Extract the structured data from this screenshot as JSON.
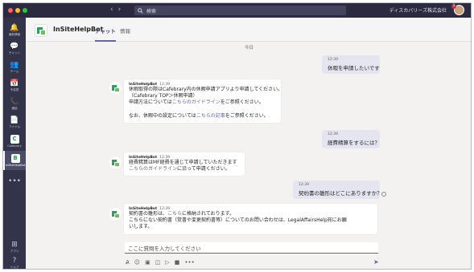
{
  "window": {
    "search_placeholder": "検索",
    "org_name": "ディスカバリーズ株式会社",
    "notification_count": "1",
    "nav_back": "‹",
    "nav_forward": "›"
  },
  "rail": {
    "items": [
      {
        "label": "最新情報",
        "icon": "bell-icon",
        "glyph": "🔔"
      },
      {
        "label": "チャット",
        "icon": "chat-icon",
        "glyph": "💬"
      },
      {
        "label": "チーム",
        "icon": "teams-icon",
        "glyph": "👥"
      },
      {
        "label": "予定表",
        "icon": "calendar-icon",
        "glyph": "📅"
      },
      {
        "label": "通話",
        "icon": "phone-icon",
        "glyph": "📞"
      },
      {
        "label": "ファイル",
        "icon": "files-icon",
        "glyph": "📄"
      },
      {
        "label": "Cafebrary",
        "icon": "cafebrary-icon",
        "glyph": "C"
      },
      {
        "label": "InSiteHelpBot",
        "icon": "insitehelpbot-icon",
        "glyph": "B"
      },
      {
        "label": "…",
        "icon": "more-icon",
        "glyph": "•••"
      }
    ],
    "bottom": [
      {
        "label": "アプリ",
        "icon": "apps-icon",
        "glyph": "⊞"
      },
      {
        "label": "ヘルプ",
        "icon": "help-icon",
        "glyph": "?"
      }
    ]
  },
  "header": {
    "bot_name": "InSiteHelpBot",
    "tabs": [
      {
        "label": "チャット",
        "active": true
      },
      {
        "label": "情報",
        "active": false
      }
    ]
  },
  "chat": {
    "date_divider": "今日",
    "messages": [
      {
        "dir": "out",
        "time": "12:39",
        "text": "休暇を申請したいです"
      },
      {
        "dir": "in",
        "sender": "InSiteHelpBot",
        "time": "12:39",
        "lines": [
          {
            "pre": "休暇取得の際はCafebrary内の休暇申請アプリより申請してください。",
            "link": "",
            "post": ""
          },
          {
            "pre": "（Cafebrary TOP＞休暇申請）",
            "link": "",
            "post": ""
          },
          {
            "pre": "申請方法については",
            "link": "こちらのガイドライン",
            "post": "をご参照ください。"
          },
          {
            "pre": "",
            "link": "",
            "post": ""
          },
          {
            "pre": "なお、休暇中の設定については",
            "link": "こちらの記事",
            "post": "をご参照ください。"
          }
        ]
      },
      {
        "dir": "out",
        "time": "12:39",
        "text": "経費精算をするには？"
      },
      {
        "dir": "in",
        "sender": "InSiteHelpBot",
        "time": "12:39",
        "lines": [
          {
            "pre": "経費精算はMF経費を通じて申請していただきます",
            "link": "",
            "post": ""
          },
          {
            "pre": "",
            "link": "こちらのガイドライン",
            "post": "に沿って申請ください。"
          }
        ]
      },
      {
        "dir": "out",
        "time": "12:39",
        "text": "契約書の雛形はどこにありますか？"
      },
      {
        "dir": "in",
        "sender": "InSiteHelpBot",
        "time": "12:39",
        "lines": [
          {
            "pre": "契約書の雛形は、",
            "link": "こちら",
            "post": "に格納されております。"
          },
          {
            "pre": "こちらにない契約書（覚書や変更契約書等）についてのお問い合わせは、LegalAffairsHelp宛にお願",
            "link": "",
            "post": ""
          },
          {
            "pre": "いします。",
            "link": "",
            "post": ""
          }
        ]
      }
    ]
  },
  "compose": {
    "placeholder": "ここに質問を入力してください",
    "tools": [
      {
        "icon": "format-icon",
        "glyph": "A̷"
      },
      {
        "icon": "emoji-icon",
        "glyph": "☺"
      },
      {
        "icon": "gif-icon",
        "glyph": "▣"
      },
      {
        "icon": "sticker-icon",
        "glyph": "◫"
      },
      {
        "icon": "schedule-icon",
        "glyph": "▷"
      },
      {
        "icon": "video-icon",
        "glyph": "■"
      },
      {
        "icon": "more-options-icon",
        "glyph": "•••"
      }
    ],
    "send_glyph": "➤"
  },
  "colors": {
    "brand": "#6264a7",
    "titlebar": "#2b2a40",
    "rail": "#33344a",
    "outgoing_bubble": "#e5e5f1",
    "bot_green": "#2e9e5b"
  }
}
